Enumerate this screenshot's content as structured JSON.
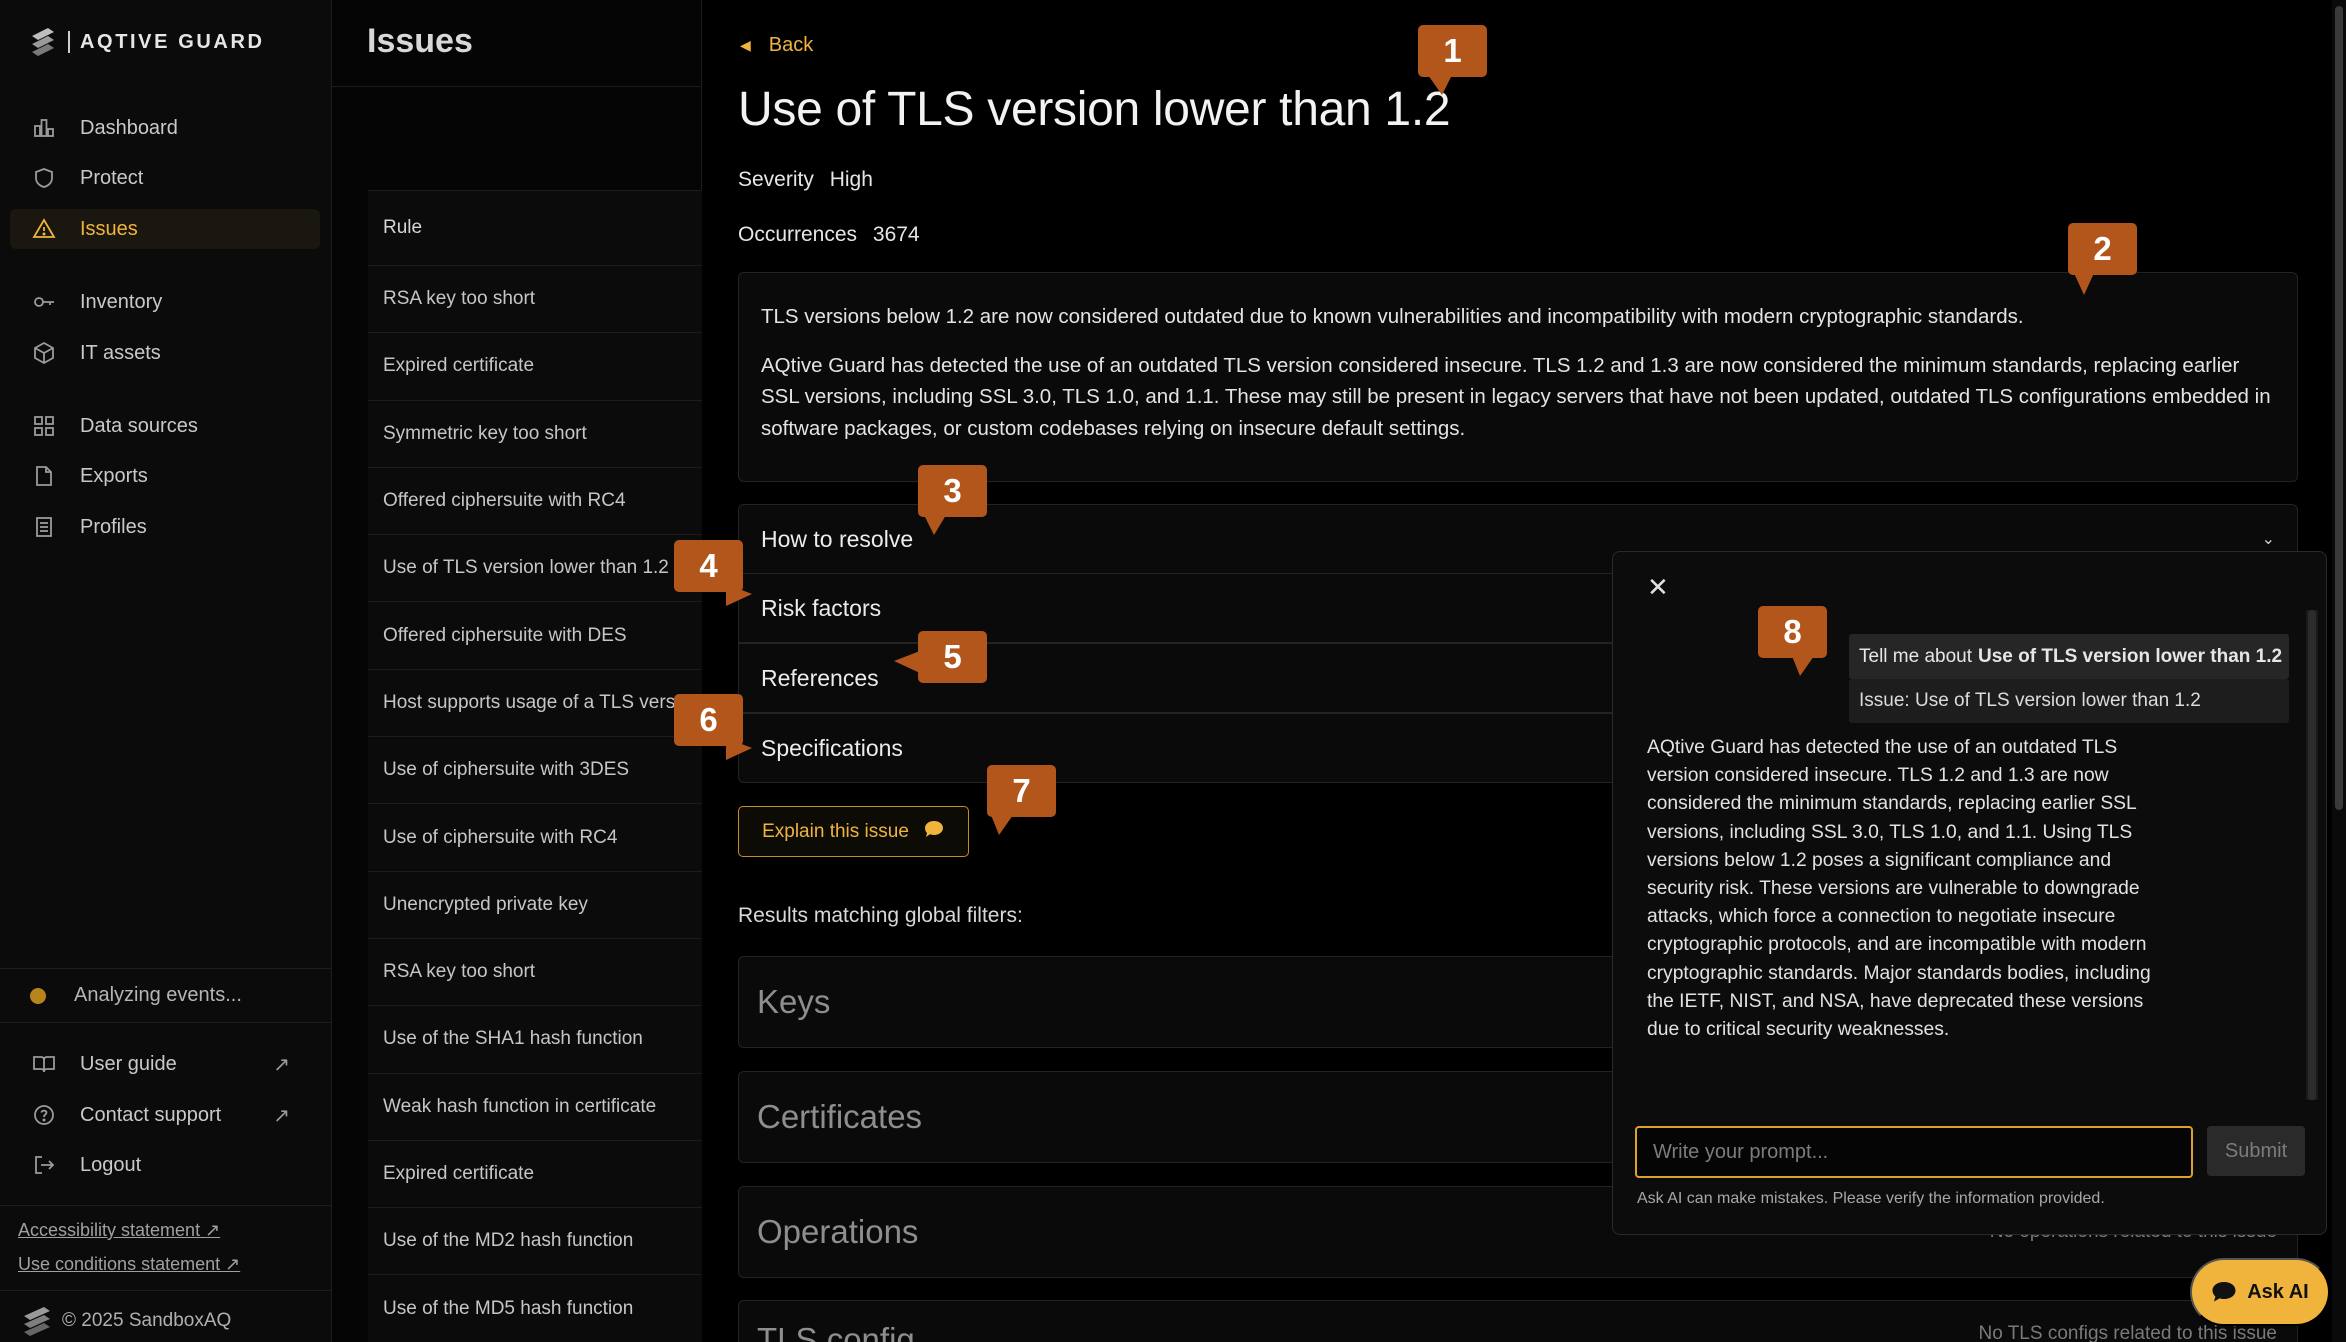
{
  "brand": {
    "name": "AQTIVE GUARD"
  },
  "sidebar": {
    "items": [
      {
        "label": "Dashboard",
        "icon": "chart-icon"
      },
      {
        "label": "Protect",
        "icon": "shield-icon"
      },
      {
        "label": "Issues",
        "icon": "warning-icon",
        "active": true
      },
      {
        "label": "Inventory",
        "icon": "key-icon"
      },
      {
        "label": "IT assets",
        "icon": "cube-icon"
      },
      {
        "label": "Data sources",
        "icon": "grid-icon"
      },
      {
        "label": "Exports",
        "icon": "export-icon"
      },
      {
        "label": "Profiles",
        "icon": "profile-icon"
      }
    ],
    "status": "Analyzing events...",
    "bottom_items": [
      {
        "label": "User guide",
        "icon": "book-icon",
        "arrow": "↗"
      },
      {
        "label": "Contact support",
        "icon": "help-icon",
        "arrow": "↗"
      },
      {
        "label": "Logout",
        "icon": "logout-icon"
      }
    ],
    "links": [
      "Accessibility statement ↗",
      "Use conditions statement ↗"
    ],
    "copyright": "© 2025 SandboxAQ"
  },
  "list": {
    "title": "Issues",
    "column_header": "Rule",
    "rows": [
      "RSA key too short",
      "Expired certificate",
      "Symmetric key too short",
      "Offered ciphersuite with RC4",
      "Use of TLS version lower than 1.2",
      "Offered ciphersuite with DES",
      "Host supports usage of a TLS vers",
      "Use of ciphersuite with 3DES",
      "Use of ciphersuite with RC4",
      "Unencrypted private key",
      "RSA key too short",
      "Use of the SHA1 hash function",
      "Weak hash function in certificate",
      "Expired certificate",
      "Use of the MD2 hash function",
      "Use of the MD5 hash function"
    ]
  },
  "detail": {
    "back_label": "Back",
    "title": "Use of TLS version lower than 1.2",
    "severity_label": "Severity",
    "severity_value": "High",
    "occurrences_label": "Occurrences",
    "occurrences_value": "3674",
    "description_p1": "TLS versions below 1.2 are now considered outdated due to known vulnerabilities and incompatibility with modern cryptographic standards.",
    "description_p2": "AQtive Guard has detected the use of an outdated TLS version considered insecure. TLS 1.2 and 1.3 are now considered the minimum standards, replacing earlier SSL versions, including SSL 3.0, TLS 1.0, and 1.1. These may still be present in legacy servers that have not been updated, outdated TLS configurations embedded in software packages, or custom codebases relying on insecure default settings.",
    "accordion": [
      "How to resolve",
      "Risk factors",
      "References",
      "Specifications"
    ],
    "explain_label": "Explain this issue",
    "results_label": "Results matching global filters:",
    "results": [
      {
        "title": "Keys",
        "note": ""
      },
      {
        "title": "Certificates",
        "note": ""
      },
      {
        "title": "Operations",
        "note": "No operations related to this issue"
      },
      {
        "title": "TLS config",
        "note": "No TLS configs related to this issue"
      }
    ]
  },
  "ai_panel": {
    "user_prompt_prefix": "Tell me about",
    "user_prompt_bold": "Use of TLS version lower than 1.2",
    "issue_context": "Issue: Use of TLS version lower than 1.2",
    "answer": "AQtive Guard has detected the use of an outdated TLS version considered insecure. TLS 1.2 and 1.3 are now considered the minimum standards, replacing earlier SSL versions, including SSL 3.0, TLS 1.0, and 1.1. Using TLS versions below 1.2 poses a significant compliance and security risk. These versions are vulnerable to downgrade attacks, which force a connection to negotiate insecure cryptographic protocols, and are incompatible with modern cryptographic standards. Major standards bodies, including the IETF, NIST, and NSA, have deprecated these versions due to critical security weaknesses.",
    "input_placeholder": "Write your prompt...",
    "submit_label": "Submit",
    "disclaimer": "Ask AI can make mistakes. Please verify the information provided."
  },
  "ask_ai_label": "Ask AI",
  "callouts": [
    "1",
    "2",
    "3",
    "4",
    "5",
    "6",
    "7",
    "8"
  ],
  "colors": {
    "accent": "#f0b43c",
    "callout": "#b3561c",
    "background": "#000000"
  }
}
